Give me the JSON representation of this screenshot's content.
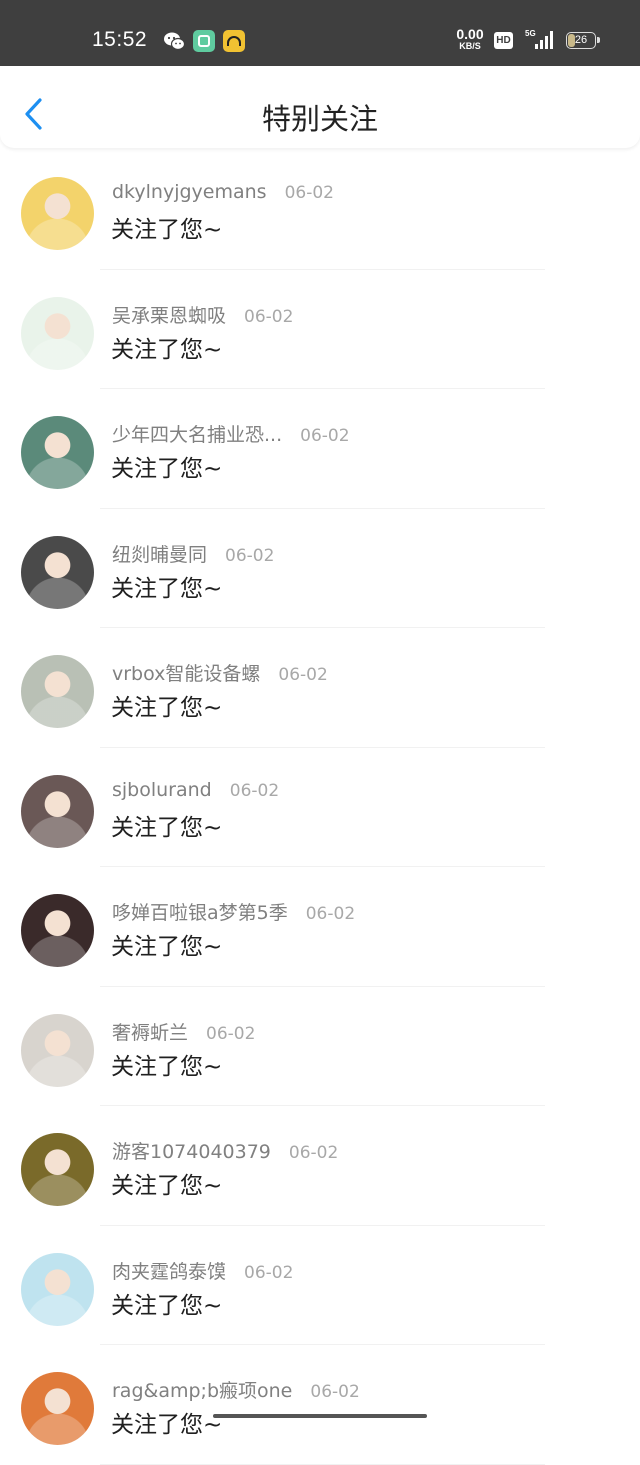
{
  "status_bar": {
    "time": "15:52",
    "net_speed": "0.00",
    "net_speed_unit": "KB/S",
    "hd_label": "HD",
    "network_type": "5G",
    "battery": "26"
  },
  "header": {
    "title": "特别关注"
  },
  "items": [
    {
      "name": "dkylnyjgyemans",
      "date": "06-02",
      "message": "关注了您~",
      "avatar_color": "#f3d36b"
    },
    {
      "name": "吴承栗恩蜘吸",
      "date": "06-02",
      "message": "关注了您~",
      "avatar_color": "#e9f3ea"
    },
    {
      "name": "少年四大名捕业恐...",
      "date": "06-02",
      "message": "关注了您~",
      "avatar_color": "#5b8a7a"
    },
    {
      "name": "纽剡晡曼同",
      "date": "06-02",
      "message": "关注了您~",
      "avatar_color": "#4a4a4a"
    },
    {
      "name": "vrbox智能设备螺",
      "date": "06-02",
      "message": "关注了您~",
      "avatar_color": "#b9c0b5"
    },
    {
      "name": "sjbolurand",
      "date": "06-02",
      "message": "关注了您~",
      "avatar_color": "#6a5856"
    },
    {
      "name": "哆婵百啦银a梦第5季",
      "date": "06-02",
      "message": "关注了您~",
      "avatar_color": "#3a2a2a"
    },
    {
      "name": "奢褥蚚兰",
      "date": "06-02",
      "message": "关注了您~",
      "avatar_color": "#d8d4ce"
    },
    {
      "name": "游客1074040379",
      "date": "06-02",
      "message": "关注了您~",
      "avatar_color": "#7a6a2a"
    },
    {
      "name": "肉夹霆鸽泰馍",
      "date": "06-02",
      "message": "关注了您~",
      "avatar_color": "#bfe3ef"
    },
    {
      "name": "rag&amp;b瘢项one",
      "date": "06-02",
      "message": "关注了您~",
      "avatar_color": "#e07a3a"
    }
  ]
}
